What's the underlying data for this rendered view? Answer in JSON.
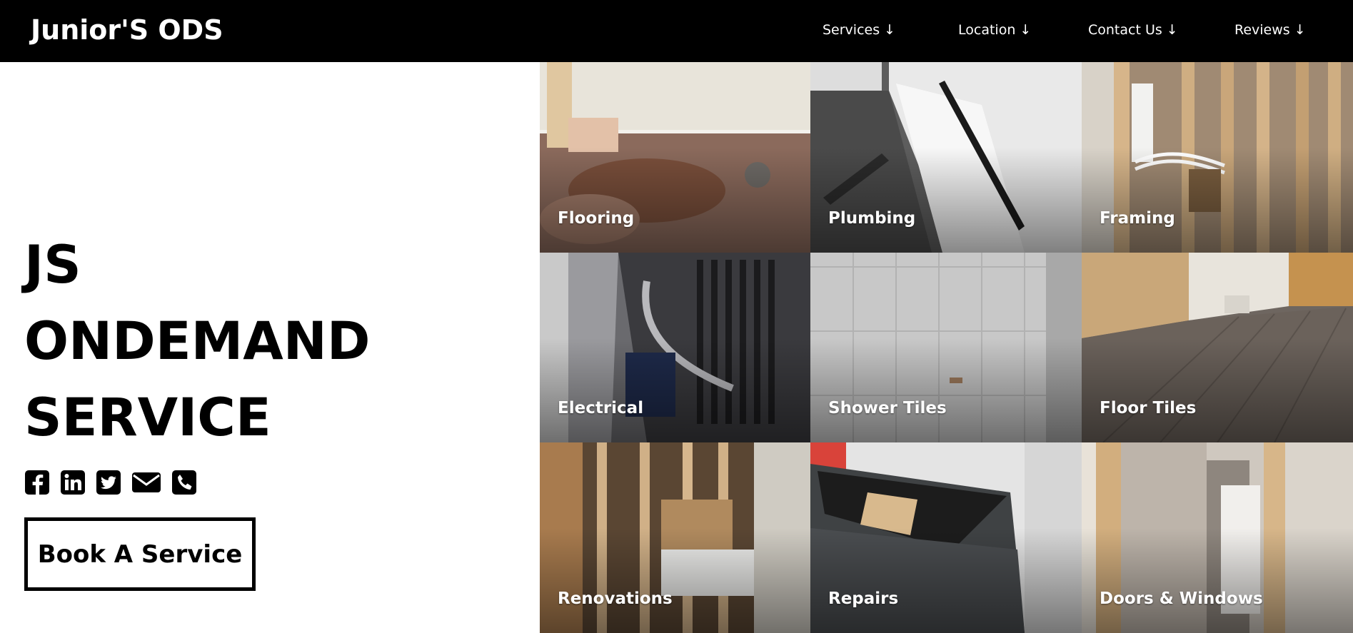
{
  "header": {
    "brand": "Junior'S ODS",
    "nav": [
      {
        "label": "Services ↓"
      },
      {
        "label": "Location ↓"
      },
      {
        "label": "Contact Us ↓"
      },
      {
        "label": "Reviews ↓"
      }
    ]
  },
  "hero": {
    "title_lines": [
      "JS",
      "ONDEMAND",
      "SERVICE"
    ],
    "social_icons": [
      "facebook-icon",
      "linkedin-icon",
      "twitter-icon",
      "email-icon",
      "phone-icon"
    ],
    "cta_label": "Book A Service"
  },
  "services": [
    {
      "label": "Flooring"
    },
    {
      "label": "Plumbing"
    },
    {
      "label": "Framing"
    },
    {
      "label": "Electrical"
    },
    {
      "label": "Shower Tiles"
    },
    {
      "label": "Floor Tiles"
    },
    {
      "label": "Renovations"
    },
    {
      "label": "Repairs"
    },
    {
      "label": "Doors & Windows"
    }
  ],
  "colors": {
    "nav_bg": "#000000",
    "text_light": "#ffffff",
    "text_dark": "#000000"
  }
}
